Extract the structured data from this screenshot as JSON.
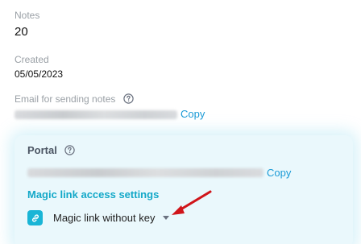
{
  "notes": {
    "label": "Notes",
    "value": "20"
  },
  "created": {
    "label": "Created",
    "value": "05/05/2023"
  },
  "email": {
    "label": "Email for sending notes",
    "copy_label": "Copy"
  },
  "portal": {
    "title": "Portal",
    "copy_label": "Copy",
    "magic_heading": "Magic link access settings",
    "magic_option": "Magic link without key"
  },
  "colors": {
    "accent": "#13a8c8",
    "link": "#1a9ad6",
    "card_bg": "#eaf8fc",
    "annotation_arrow": "#d0151a"
  },
  "icons": {
    "help": "help-circle-icon",
    "link": "link-icon",
    "caret": "caret-down-icon",
    "annotation": "red-arrow-annotation"
  }
}
